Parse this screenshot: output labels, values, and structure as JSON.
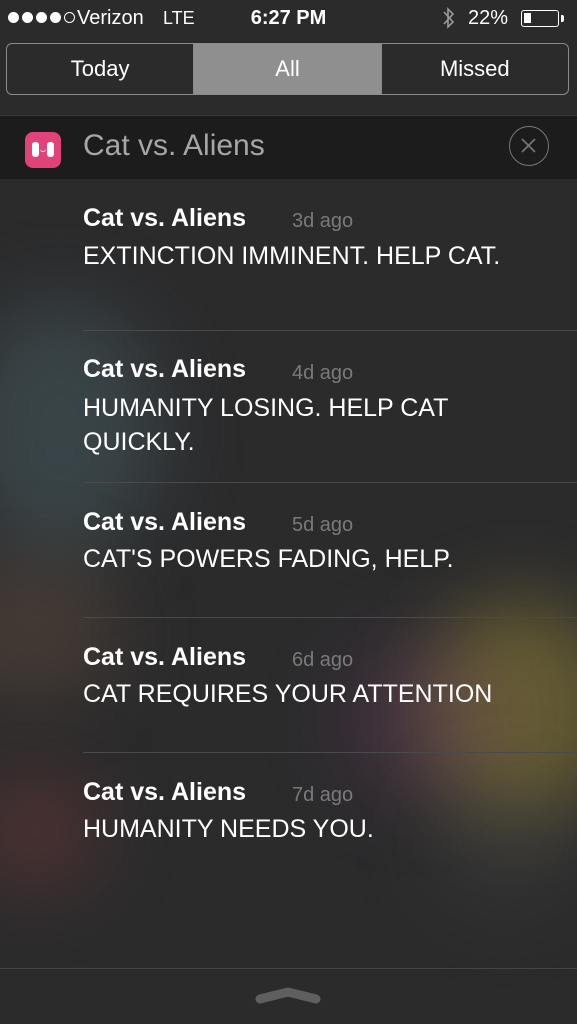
{
  "status_bar": {
    "carrier": "Verizon",
    "network": "LTE",
    "time": "6:27 PM",
    "battery_percent": "22%",
    "battery_level": 0.22,
    "signal_bars": 4,
    "signal_max": 5,
    "bluetooth_icon": "bluetooth-icon"
  },
  "tabs": [
    {
      "label": "Today",
      "active": false
    },
    {
      "label": "All",
      "active": true
    },
    {
      "label": "Missed",
      "active": false
    }
  ],
  "app_group": {
    "title": "Cat vs. Aliens",
    "icon": "cat-app-icon",
    "icon_color": "#e2427a",
    "close_icon": "close-icon"
  },
  "notifications": [
    {
      "app": "Cat vs. Aliens",
      "time": "3d ago",
      "message": "EXTINCTION IMMINENT. HELP CAT."
    },
    {
      "app": "Cat vs. Aliens",
      "time": "4d ago",
      "message": "HUMANITY LOSING. HELP CAT QUICKLY."
    },
    {
      "app": "Cat vs. Aliens",
      "time": "5d ago",
      "message": "CAT'S POWERS FADING, HELP."
    },
    {
      "app": "Cat vs. Aliens",
      "time": "6d ago",
      "message": "CAT REQUIRES YOUR ATTENTION"
    },
    {
      "app": "Cat vs. Aliens",
      "time": "7d ago",
      "message": "HUMANITY NEEDS YOU."
    }
  ],
  "grabber_icon": "grabber-handle-icon"
}
